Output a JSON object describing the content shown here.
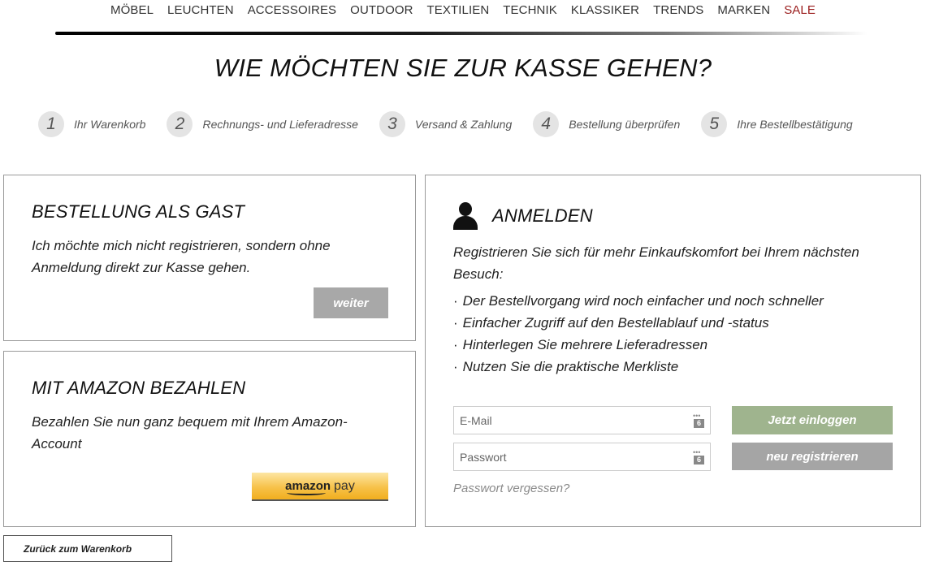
{
  "nav": {
    "items": [
      {
        "label": "MÖBEL"
      },
      {
        "label": "LEUCHTEN"
      },
      {
        "label": "ACCESSOIRES"
      },
      {
        "label": "OUTDOOR"
      },
      {
        "label": "TEXTILIEN"
      },
      {
        "label": "TECHNIK"
      },
      {
        "label": "KLASSIKER"
      },
      {
        "label": "TRENDS"
      },
      {
        "label": "MARKEN"
      },
      {
        "label": "SALE"
      }
    ],
    "sale_color": "#9a1c1c"
  },
  "page_title": "WIE MÖCHTEN SIE ZUR KASSE GEHEN?",
  "steps": [
    {
      "num": "1",
      "label": "Ihr Warenkorb"
    },
    {
      "num": "2",
      "label": "Rechnungs- und Lieferadresse"
    },
    {
      "num": "3",
      "label": "Versand & Zahlung"
    },
    {
      "num": "4",
      "label": "Bestellung überprüfen"
    },
    {
      "num": "5",
      "label": "Ihre Bestellbestätigung"
    }
  ],
  "guest": {
    "title": "BESTELLUNG ALS GAST",
    "text": "Ich möchte mich nicht registrieren, sondern ohne Anmeldung direkt zur Kasse gehen.",
    "button": "weiter"
  },
  "amazon": {
    "title": "MIT AMAZON BEZAHLEN",
    "text": "Bezahlen Sie nun ganz bequem mit Ihrem Amazon-Account",
    "logo_word": "amazon",
    "pay_word": "pay"
  },
  "login": {
    "icon": "person-icon",
    "title": "ANMELDEN",
    "intro": "Registrieren Sie sich für mehr Einkaufskomfort bei Ihrem nächsten Besuch:",
    "benefits": [
      "Der Bestellvorgang wird noch einfacher und noch schneller",
      "Einfacher Zugriff auf den Bestellablauf und -status",
      "Hinterlegen Sie mehrere Lieferadressen",
      "Nutzen Sie die praktische Merkliste"
    ],
    "email_placeholder": "E-Mail",
    "email_value": "",
    "password_placeholder": "Passwort",
    "password_value": "",
    "field_icon_badge": "6",
    "login_button": "Jetzt einloggen",
    "register_button": "neu registrieren",
    "forgot_link": "Passwort vergessen?",
    "colors": {
      "login_button": "#9fb48e",
      "register_button": "#a5a5a5"
    }
  },
  "back_button": "Zurück zum Warenkorb"
}
